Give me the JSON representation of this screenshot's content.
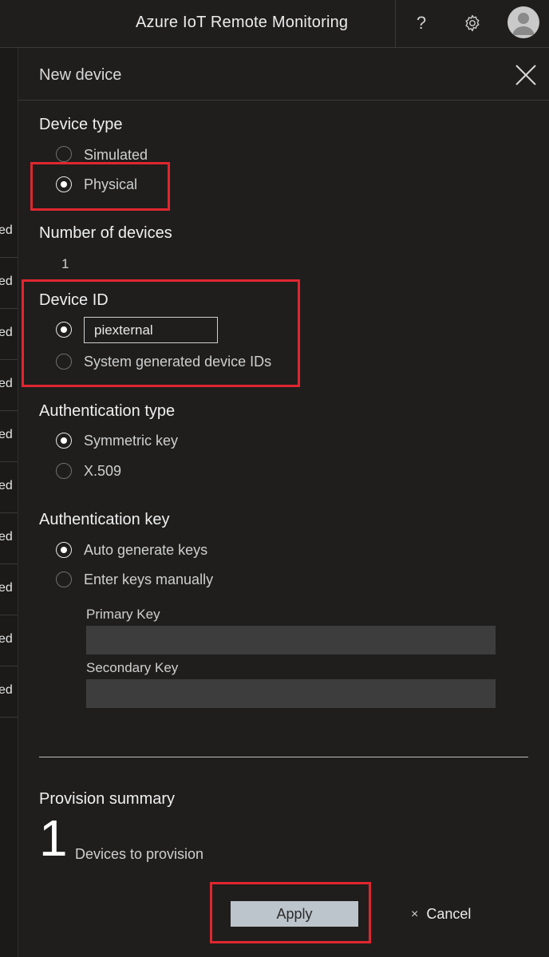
{
  "header": {
    "app_title": "Azure IoT Remote Monitoring",
    "help_glyph": "?",
    "icons": [
      "question-icon",
      "gear-icon",
      "user-avatar-icon"
    ]
  },
  "background_rows": [
    "ed",
    "ed",
    "ed",
    "ed",
    "ed",
    "ed",
    "ed",
    "ed",
    "ed",
    "ed"
  ],
  "flyout": {
    "title": "New device",
    "device_type": {
      "label": "Device type",
      "options": [
        {
          "label": "Simulated",
          "selected": false
        },
        {
          "label": "Physical",
          "selected": true
        }
      ]
    },
    "number_of_devices": {
      "label": "Number of devices",
      "value": "1"
    },
    "device_id": {
      "label": "Device ID",
      "input_value": "piexternal",
      "alt_option": "System generated device IDs",
      "custom_selected": true
    },
    "auth_type": {
      "label": "Authentication type",
      "options": [
        {
          "label": "Symmetric key",
          "selected": true
        },
        {
          "label": "X.509",
          "selected": false
        }
      ]
    },
    "auth_key": {
      "label": "Authentication key",
      "options": [
        {
          "label": "Auto generate keys",
          "selected": true
        },
        {
          "label": "Enter keys manually",
          "selected": false
        }
      ],
      "primary_key_label": "Primary Key",
      "secondary_key_label": "Secondary Key",
      "primary_key_value": "",
      "secondary_key_value": ""
    },
    "summary": {
      "label": "Provision summary",
      "count": "1",
      "caption": "Devices to provision"
    },
    "actions": {
      "apply": "Apply",
      "cancel": "Cancel",
      "cancel_glyph": "×"
    }
  },
  "colors": {
    "highlight": "#e0262f",
    "apply_button": "#bcc4cc",
    "panel_bg": "#1f1e1d"
  }
}
